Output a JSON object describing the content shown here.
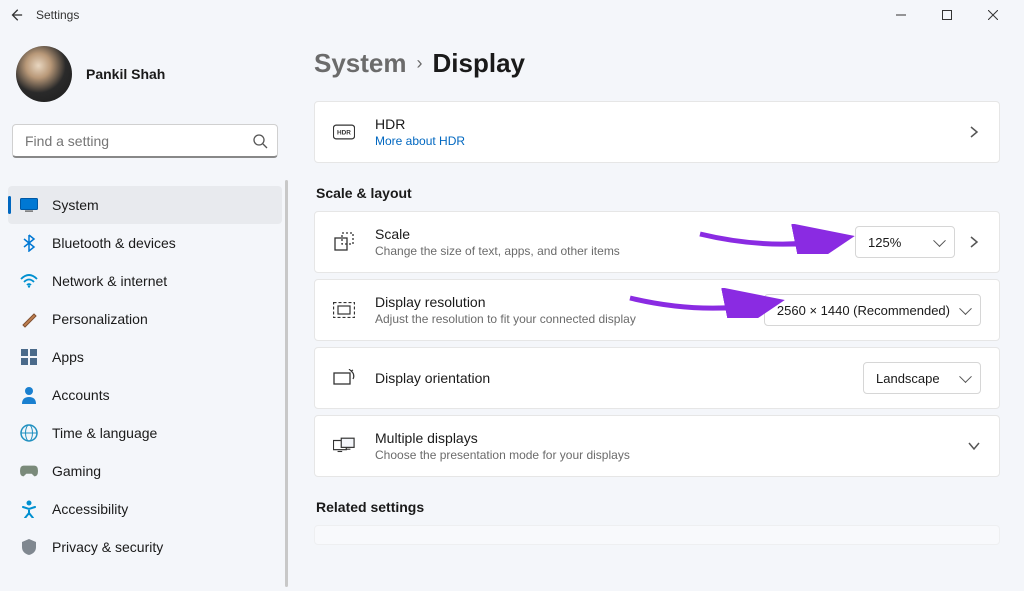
{
  "window": {
    "title": "Settings"
  },
  "profile": {
    "name": "Pankil Shah"
  },
  "search": {
    "placeholder": "Find a setting"
  },
  "sidebar": {
    "items": [
      {
        "label": "System",
        "icon": "display-icon",
        "active": true
      },
      {
        "label": "Bluetooth & devices",
        "icon": "bluetooth-icon"
      },
      {
        "label": "Network & internet",
        "icon": "wifi-icon"
      },
      {
        "label": "Personalization",
        "icon": "brush-icon"
      },
      {
        "label": "Apps",
        "icon": "apps-icon"
      },
      {
        "label": "Accounts",
        "icon": "person-icon"
      },
      {
        "label": "Time & language",
        "icon": "globe-clock-icon"
      },
      {
        "label": "Gaming",
        "icon": "gamepad-icon"
      },
      {
        "label": "Accessibility",
        "icon": "accessibility-icon"
      },
      {
        "label": "Privacy & security",
        "icon": "shield-icon"
      }
    ]
  },
  "breadcrumb": {
    "root": "System",
    "current": "Display"
  },
  "hdr": {
    "title": "HDR",
    "link": "More about HDR"
  },
  "sections": {
    "scale_layout": "Scale & layout",
    "related": "Related settings"
  },
  "scale": {
    "title": "Scale",
    "subtitle": "Change the size of text, apps, and other items",
    "value": "125%"
  },
  "resolution": {
    "title": "Display resolution",
    "subtitle": "Adjust the resolution to fit your connected display",
    "value": "2560 × 1440 (Recommended)"
  },
  "orientation": {
    "title": "Display orientation",
    "value": "Landscape"
  },
  "multiple": {
    "title": "Multiple displays",
    "subtitle": "Choose the presentation mode for your displays"
  }
}
